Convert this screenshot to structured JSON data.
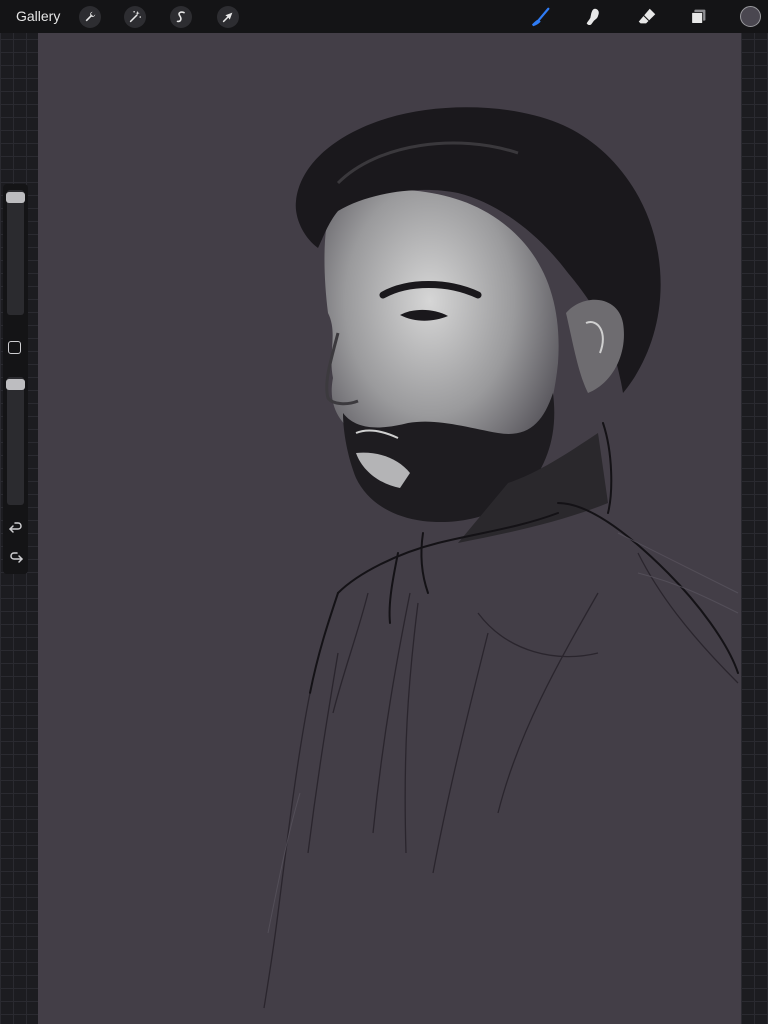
{
  "app": {
    "gallery_label": "Gallery"
  },
  "toolbar_left": [
    {
      "icon": "wrench-icon",
      "name": "actions"
    },
    {
      "icon": "magic-wand-icon",
      "name": "adjustments"
    },
    {
      "icon": "selection-s-icon",
      "name": "selection"
    },
    {
      "icon": "arrow-cursor-icon",
      "name": "transform"
    }
  ],
  "toolbar_right": [
    {
      "icon": "brush-icon",
      "name": "paint",
      "active": true
    },
    {
      "icon": "smudge-icon",
      "name": "smudge",
      "active": false
    },
    {
      "icon": "eraser-icon",
      "name": "erase",
      "active": false
    },
    {
      "icon": "layers-icon",
      "name": "layers",
      "active": false
    }
  ],
  "colors": {
    "canvas_bg": "#433e47",
    "active_tool": "#2f7cf6",
    "current_color": "#4a4750"
  },
  "sidebar": {
    "brush_size_level": 0.05,
    "opacity_level": 0.05
  }
}
